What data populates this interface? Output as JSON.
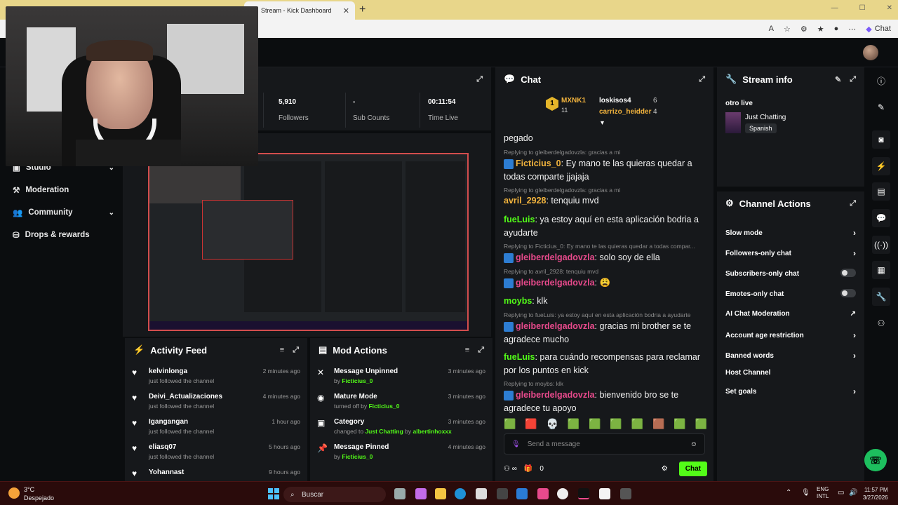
{
  "browser": {
    "tab_title": "Stream - Kick Dashboard",
    "tab_close": "✕",
    "new_tab": "+",
    "chat_button": "Chat"
  },
  "sidebar": {
    "items": [
      {
        "label": "Studio"
      },
      {
        "label": "Moderation"
      },
      {
        "label": "Community"
      },
      {
        "label": "Drops & rewards"
      }
    ]
  },
  "stats": [
    {
      "value": "5,910",
      "label": "Followers"
    },
    {
      "value": "-",
      "label": "Sub Counts"
    },
    {
      "value": "00:11:54",
      "label": "Time Live"
    }
  ],
  "activity_feed": {
    "title": "Activity Feed",
    "rows": [
      {
        "name": "kelvinlonga",
        "sub": "just followed the channel",
        "time": "2 minutes ago"
      },
      {
        "name": "Deivi_Actualizaciones",
        "sub": "just followed the channel",
        "time": "4 minutes ago"
      },
      {
        "name": "Igangangan",
        "sub": "just followed the channel",
        "time": "1 hour ago"
      },
      {
        "name": "eliasq07",
        "sub": "just followed the channel",
        "time": "5 hours ago"
      },
      {
        "name": "Yohannast",
        "sub": "",
        "time": "9 hours ago"
      }
    ]
  },
  "mod_actions": {
    "title": "Mod Actions",
    "rows": [
      {
        "name": "Message Unpinned",
        "sub_prefix": "by",
        "user": "Ficticius_0",
        "time": "3 minutes ago"
      },
      {
        "name": "Mature Mode",
        "sub_prefix": "turned off by",
        "user": "Ficticius_0",
        "time": "3 minutes ago"
      },
      {
        "name": "Category",
        "sub_prefix": "changed to",
        "user": "Just Chatting",
        "sub_mid": "by",
        "user2": "albertinhoxxx",
        "time": "3 minutes ago"
      },
      {
        "name": "Message Pinned",
        "sub_prefix": "by",
        "user": "Ficticius_0",
        "time": "4 minutes ago"
      }
    ]
  },
  "chat": {
    "title": "Chat",
    "leaders": [
      {
        "rank": "1",
        "name": "MXNK1",
        "count": "11"
      },
      {
        "name": "loskisos4",
        "count": "6"
      },
      {
        "name": "carrizo_heidder",
        "count": "4"
      }
    ],
    "messages": [
      {
        "text": "pegado"
      },
      {
        "reply": "Replying to gleiberdelgadovzla: gracias a mi",
        "user": "Ficticius_0",
        "text": ": Ey mano te las quieras quedar a todas comparte jjajaja"
      },
      {
        "reply": "Replying to gleiberdelgadovzla: gracias a mi",
        "user": "avril_2928",
        "text": ": tenquiu mvd"
      },
      {
        "user": "fueLuis",
        "text": ": ya estoy aquí en esta aplicación bodria a ayudarte"
      },
      {
        "reply": "Replying to Ficticius_0: Ey mano te las quieras quedar a todas compar...",
        "user": "gleiberdelgadovzla",
        "text": ": solo soy de ella"
      },
      {
        "reply": "Replying to avril_2928: tenquiu mvd",
        "user": "gleiberdelgadovzla",
        "text": ":"
      },
      {
        "user": "moybs",
        "text": ": klk"
      },
      {
        "reply": "Replying to fueLuis: ya estoy aquí en esta aplicación bodria a ayudarte",
        "user": "gleiberdelgadovzla",
        "text": ": gracias mi brother se te agradece mucho"
      },
      {
        "user": "fueLuis",
        "text": ": para cuándo recompensas para reclamar por los puntos en kick"
      },
      {
        "reply": "Replying to moybs: klk",
        "user": "gleiberdelgadovzla",
        "text": ": bienvenido bro se te agradece tu apoyo"
      }
    ],
    "input_placeholder": "Send a message",
    "points": "0",
    "send_label": "Chat"
  },
  "stream_info": {
    "title": "Stream info",
    "stream_title": "otro live",
    "category": "Just Chatting",
    "language": "Spanish"
  },
  "channel_actions": {
    "title": "Channel Actions",
    "items": [
      {
        "label": "Slow mode"
      },
      {
        "label": "Followers-only chat"
      },
      {
        "label": "Subscribers-only chat"
      },
      {
        "label": "Emotes-only chat"
      },
      {
        "label": "AI Chat Moderation"
      },
      {
        "label": "Account age restriction"
      },
      {
        "label": "Banned words"
      },
      {
        "label": "Host Channel"
      },
      {
        "label": "Set goals"
      }
    ]
  },
  "taskbar": {
    "weather_temp": "3°C",
    "weather_desc": "Despejado",
    "search_label": "Buscar",
    "lang": "ENG",
    "layout": "INTL",
    "time": "11:57 PM",
    "date": "3/27/2026"
  },
  "colors": {
    "accent": "#53fc18",
    "bg": "#0b0d0f",
    "panel": "#16181b"
  }
}
